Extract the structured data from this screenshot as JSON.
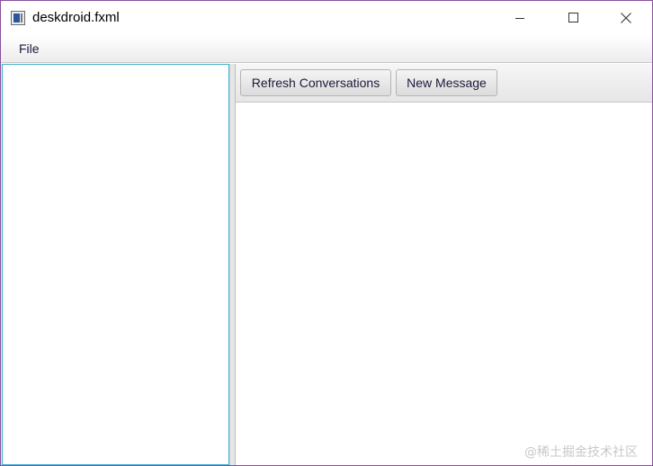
{
  "window": {
    "title": "deskdroid.fxml",
    "icon": "app-window-icon",
    "controls": {
      "minimize_icon": "minimize-icon",
      "maximize_icon": "maximize-icon",
      "close_icon": "close-icon"
    }
  },
  "menubar": {
    "items": [
      {
        "label": "File"
      }
    ]
  },
  "toolbar": {
    "refresh_label": "Refresh Conversations",
    "new_message_label": "New Message"
  },
  "watermark": {
    "text": "@稀土掘金技术社区"
  },
  "colors": {
    "window_border": "#8a4fa0",
    "left_pane_focus_border": "#3fb0cf",
    "button_text": "#1a1a3a"
  }
}
